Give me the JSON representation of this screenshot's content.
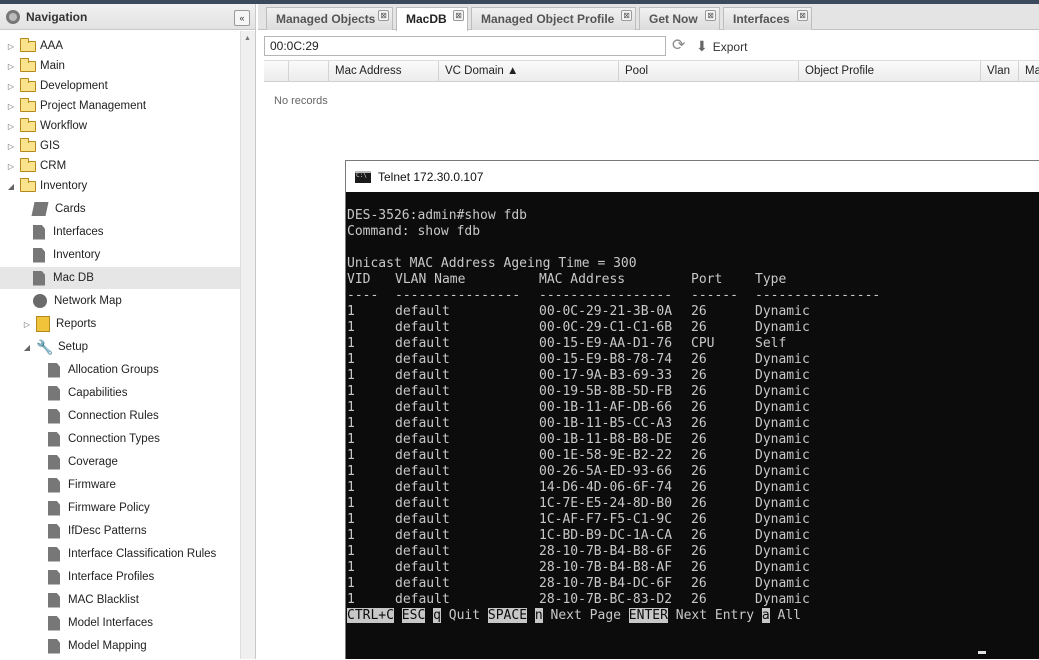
{
  "sidebar": {
    "title": "Navigation",
    "collapse_label": "«",
    "items": [
      {
        "label": "AAA",
        "icon": "folder-icon",
        "expander": "▷"
      },
      {
        "label": "Main",
        "icon": "folder-icon",
        "expander": "▷"
      },
      {
        "label": "Development",
        "icon": "folder-icon",
        "expander": "▷"
      },
      {
        "label": "Project Management",
        "icon": "folder-icon",
        "expander": "▷"
      },
      {
        "label": "Workflow",
        "icon": "folder-icon",
        "expander": "▷"
      },
      {
        "label": "GIS",
        "icon": "folder-icon",
        "expander": "▷"
      },
      {
        "label": "CRM",
        "icon": "folder-icon",
        "expander": "▷"
      },
      {
        "label": "Inventory",
        "icon": "folder-icon",
        "expander": "◢"
      },
      {
        "label": "Cards",
        "icon": "cards-icon"
      },
      {
        "label": "Interfaces",
        "icon": "document-icon"
      },
      {
        "label": "Inventory",
        "icon": "document-icon"
      },
      {
        "label": "Mac DB",
        "icon": "document-icon",
        "selected": true
      },
      {
        "label": "Network Map",
        "icon": "globe-icon"
      },
      {
        "label": "Reports",
        "icon": "reports-icon",
        "expander": "▷"
      },
      {
        "label": "Setup",
        "icon": "wrench-icon",
        "expander": "◢"
      },
      {
        "label": "Allocation Groups",
        "icon": "document-icon"
      },
      {
        "label": "Capabilities",
        "icon": "document-icon"
      },
      {
        "label": "Connection Rules",
        "icon": "document-icon"
      },
      {
        "label": "Connection Types",
        "icon": "document-icon"
      },
      {
        "label": "Coverage",
        "icon": "document-icon"
      },
      {
        "label": "Firmware",
        "icon": "document-icon"
      },
      {
        "label": "Firmware Policy",
        "icon": "document-icon"
      },
      {
        "label": "IfDesc Patterns",
        "icon": "document-icon"
      },
      {
        "label": "Interface Classification Rules",
        "icon": "document-icon"
      },
      {
        "label": "Interface Profiles",
        "icon": "document-icon"
      },
      {
        "label": "MAC Blacklist",
        "icon": "document-icon"
      },
      {
        "label": "Model Interfaces",
        "icon": "document-icon"
      },
      {
        "label": "Model Mapping",
        "icon": "document-icon"
      }
    ]
  },
  "tabs": [
    {
      "label": "Managed Objects"
    },
    {
      "label": "MacDB",
      "active": true
    },
    {
      "label": "Managed Object Profile"
    },
    {
      "label": "Get Now"
    },
    {
      "label": "Interfaces"
    }
  ],
  "tab_close": "⊠",
  "toolbar": {
    "search_value": "00:0C:29",
    "export_label": "Export",
    "refresh_icon": "refresh-icon",
    "export_icon": "down-arrow-icon"
  },
  "grid": {
    "columns": [
      "",
      "Mac Address",
      "VC Domain ▲",
      "Pool",
      "Object Profile",
      "Vlan",
      "Ma"
    ],
    "empty_text": "No records"
  },
  "telnet": {
    "title": "Telnet 172.30.0.107",
    "prompt_line": "DES-3526:admin#show fdb",
    "command_line": "Command: show fdb",
    "ageing_line": "Unicast MAC Address Ageing Time = 300",
    "headers": [
      "VID",
      "VLAN Name",
      "MAC Address",
      "Port",
      "Type"
    ],
    "separators": [
      "----",
      "----------------",
      "-----------------",
      "------",
      "----------------"
    ],
    "rows": [
      [
        "1",
        "default",
        "00-0C-29-21-3B-0A",
        "26",
        "Dynamic"
      ],
      [
        "1",
        "default",
        "00-0C-29-C1-C1-6B",
        "26",
        "Dynamic"
      ],
      [
        "1",
        "default",
        "00-15-E9-AA-D1-76",
        "CPU",
        "Self"
      ],
      [
        "1",
        "default",
        "00-15-E9-B8-78-74",
        "26",
        "Dynamic"
      ],
      [
        "1",
        "default",
        "00-17-9A-B3-69-33",
        "26",
        "Dynamic"
      ],
      [
        "1",
        "default",
        "00-19-5B-8B-5D-FB",
        "26",
        "Dynamic"
      ],
      [
        "1",
        "default",
        "00-1B-11-AF-DB-66",
        "26",
        "Dynamic"
      ],
      [
        "1",
        "default",
        "00-1B-11-B5-CC-A3",
        "26",
        "Dynamic"
      ],
      [
        "1",
        "default",
        "00-1B-11-B8-B8-DE",
        "26",
        "Dynamic"
      ],
      [
        "1",
        "default",
        "00-1E-58-9E-B2-22",
        "26",
        "Dynamic"
      ],
      [
        "1",
        "default",
        "00-26-5A-ED-93-66",
        "26",
        "Dynamic"
      ],
      [
        "1",
        "default",
        "14-D6-4D-06-6F-74",
        "26",
        "Dynamic"
      ],
      [
        "1",
        "default",
        "1C-7E-E5-24-8D-B0",
        "26",
        "Dynamic"
      ],
      [
        "1",
        "default",
        "1C-AF-F7-F5-C1-9C",
        "26",
        "Dynamic"
      ],
      [
        "1",
        "default",
        "1C-BD-B9-DC-1A-CA",
        "26",
        "Dynamic"
      ],
      [
        "1",
        "default",
        "28-10-7B-B4-B8-6F",
        "26",
        "Dynamic"
      ],
      [
        "1",
        "default",
        "28-10-7B-B4-B8-AF",
        "26",
        "Dynamic"
      ],
      [
        "1",
        "default",
        "28-10-7B-B4-DC-6F",
        "26",
        "Dynamic"
      ],
      [
        "1",
        "default",
        "28-10-7B-BC-83-D2",
        "26",
        "Dynamic"
      ]
    ],
    "footer": [
      {
        "text": "CTRL+C",
        "hl": true
      },
      {
        "text": " ",
        "hl": false
      },
      {
        "text": "ESC",
        "hl": true
      },
      {
        "text": " ",
        "hl": false
      },
      {
        "text": "q",
        "hl": true
      },
      {
        "text": " Quit ",
        "hl": false
      },
      {
        "text": "SPACE",
        "hl": true
      },
      {
        "text": " ",
        "hl": false
      },
      {
        "text": "n",
        "hl": true
      },
      {
        "text": " Next Page ",
        "hl": false
      },
      {
        "text": "ENTER",
        "hl": true
      },
      {
        "text": " Next Entry ",
        "hl": false
      },
      {
        "text": "a",
        "hl": true
      },
      {
        "text": " All",
        "hl": false
      }
    ]
  }
}
